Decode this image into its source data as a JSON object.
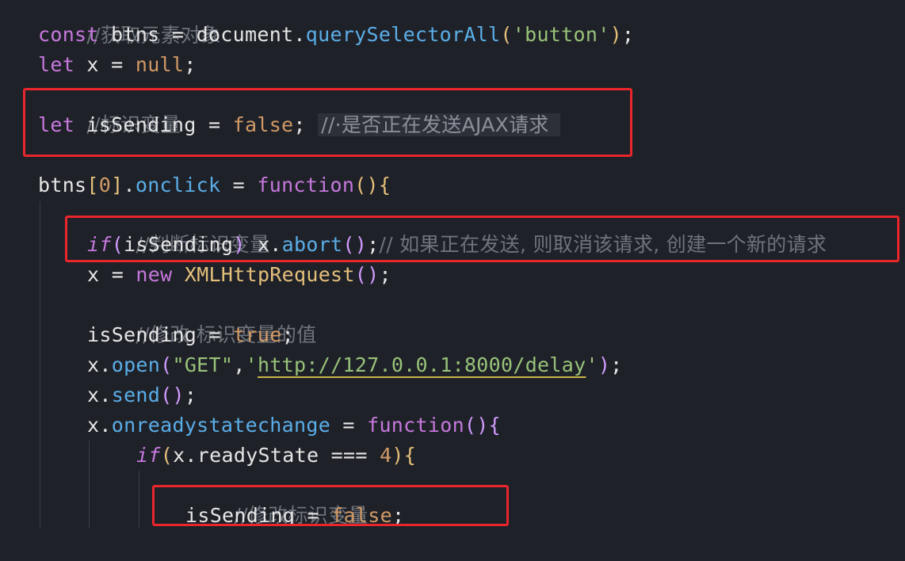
{
  "code": {
    "line1_comment": "//获取元素对象",
    "line2": {
      "kw": "const",
      "name": "btns",
      "eq": " = ",
      "obj": "document",
      "dot": ".",
      "method": "querySelectorAll",
      "open": "(",
      "arg": "'button'",
      "close": ")",
      "end": ";"
    },
    "line3": {
      "kw": "let",
      "name": "x",
      "eq": " = ",
      "val": "null",
      "end": ";"
    },
    "line4_comment": "//标识变量",
    "line5": {
      "kw": "let",
      "name": "isSending",
      "eq": " = ",
      "val": "false",
      "end": ";",
      "ghost": "//·是否正在发送AJAX请求"
    },
    "line6": {
      "obj": "btns",
      "lb": "[",
      "idx": "0",
      "rb": "]",
      "dot": ".",
      "prop": "onclick",
      "eq": " = ",
      "kw": "function",
      "parens": "()",
      "brace": "{"
    },
    "line7_comment": "//判断标识变量",
    "line8": {
      "kw": "if",
      "open": "(",
      "cond": "isSending",
      "close": ")",
      "obj": " x",
      "dot": ".",
      "method": "abort",
      "call": "()",
      "end": ";",
      "comment": "// 如果正在发送, 则取消该请求, 创建一个新的请求"
    },
    "line9": {
      "name": "x",
      "eq": " = ",
      "kw": "new",
      "cls": "XMLHttpRequest",
      "call": "()",
      "end": ";"
    },
    "line10_comment": "//修改 标识变量的值",
    "line11": {
      "name": "isSending",
      "eq": " = ",
      "val": "true",
      "end": ";"
    },
    "line12": {
      "obj": "x",
      "dot": ".",
      "method": "open",
      "open": "(",
      "arg1": "\"GET\"",
      "comma": ",",
      "q1": "'",
      "url": "http://127.0.0.1:8000/delay",
      "q2": "'",
      "close": ")",
      "end": ";"
    },
    "line13": {
      "obj": "x",
      "dot": ".",
      "method": "send",
      "call": "()",
      "end": ";"
    },
    "line14": {
      "obj": "x",
      "dot": ".",
      "prop": "onreadystatechange",
      "eq": " = ",
      "kw": "function",
      "parens": "()",
      "brace": "{"
    },
    "line15": {
      "kw": "if",
      "open": "(",
      "obj": "x",
      "dot": ".",
      "prop": "readyState",
      "op": " === ",
      "num": "4",
      "close": ")",
      "brace": "{"
    },
    "line16_comment": "//修改标识变量",
    "line17": {
      "name": "isSending",
      "eq": " = ",
      "val": "false",
      "end": ";"
    }
  },
  "colors": {
    "background": "#1f2128",
    "highlight_box": "#e8262b",
    "keyword": "#c678dd",
    "function_property": "#5aaee8",
    "string": "#98c379",
    "literal": "#d19a66",
    "comment": "#6e737c"
  }
}
